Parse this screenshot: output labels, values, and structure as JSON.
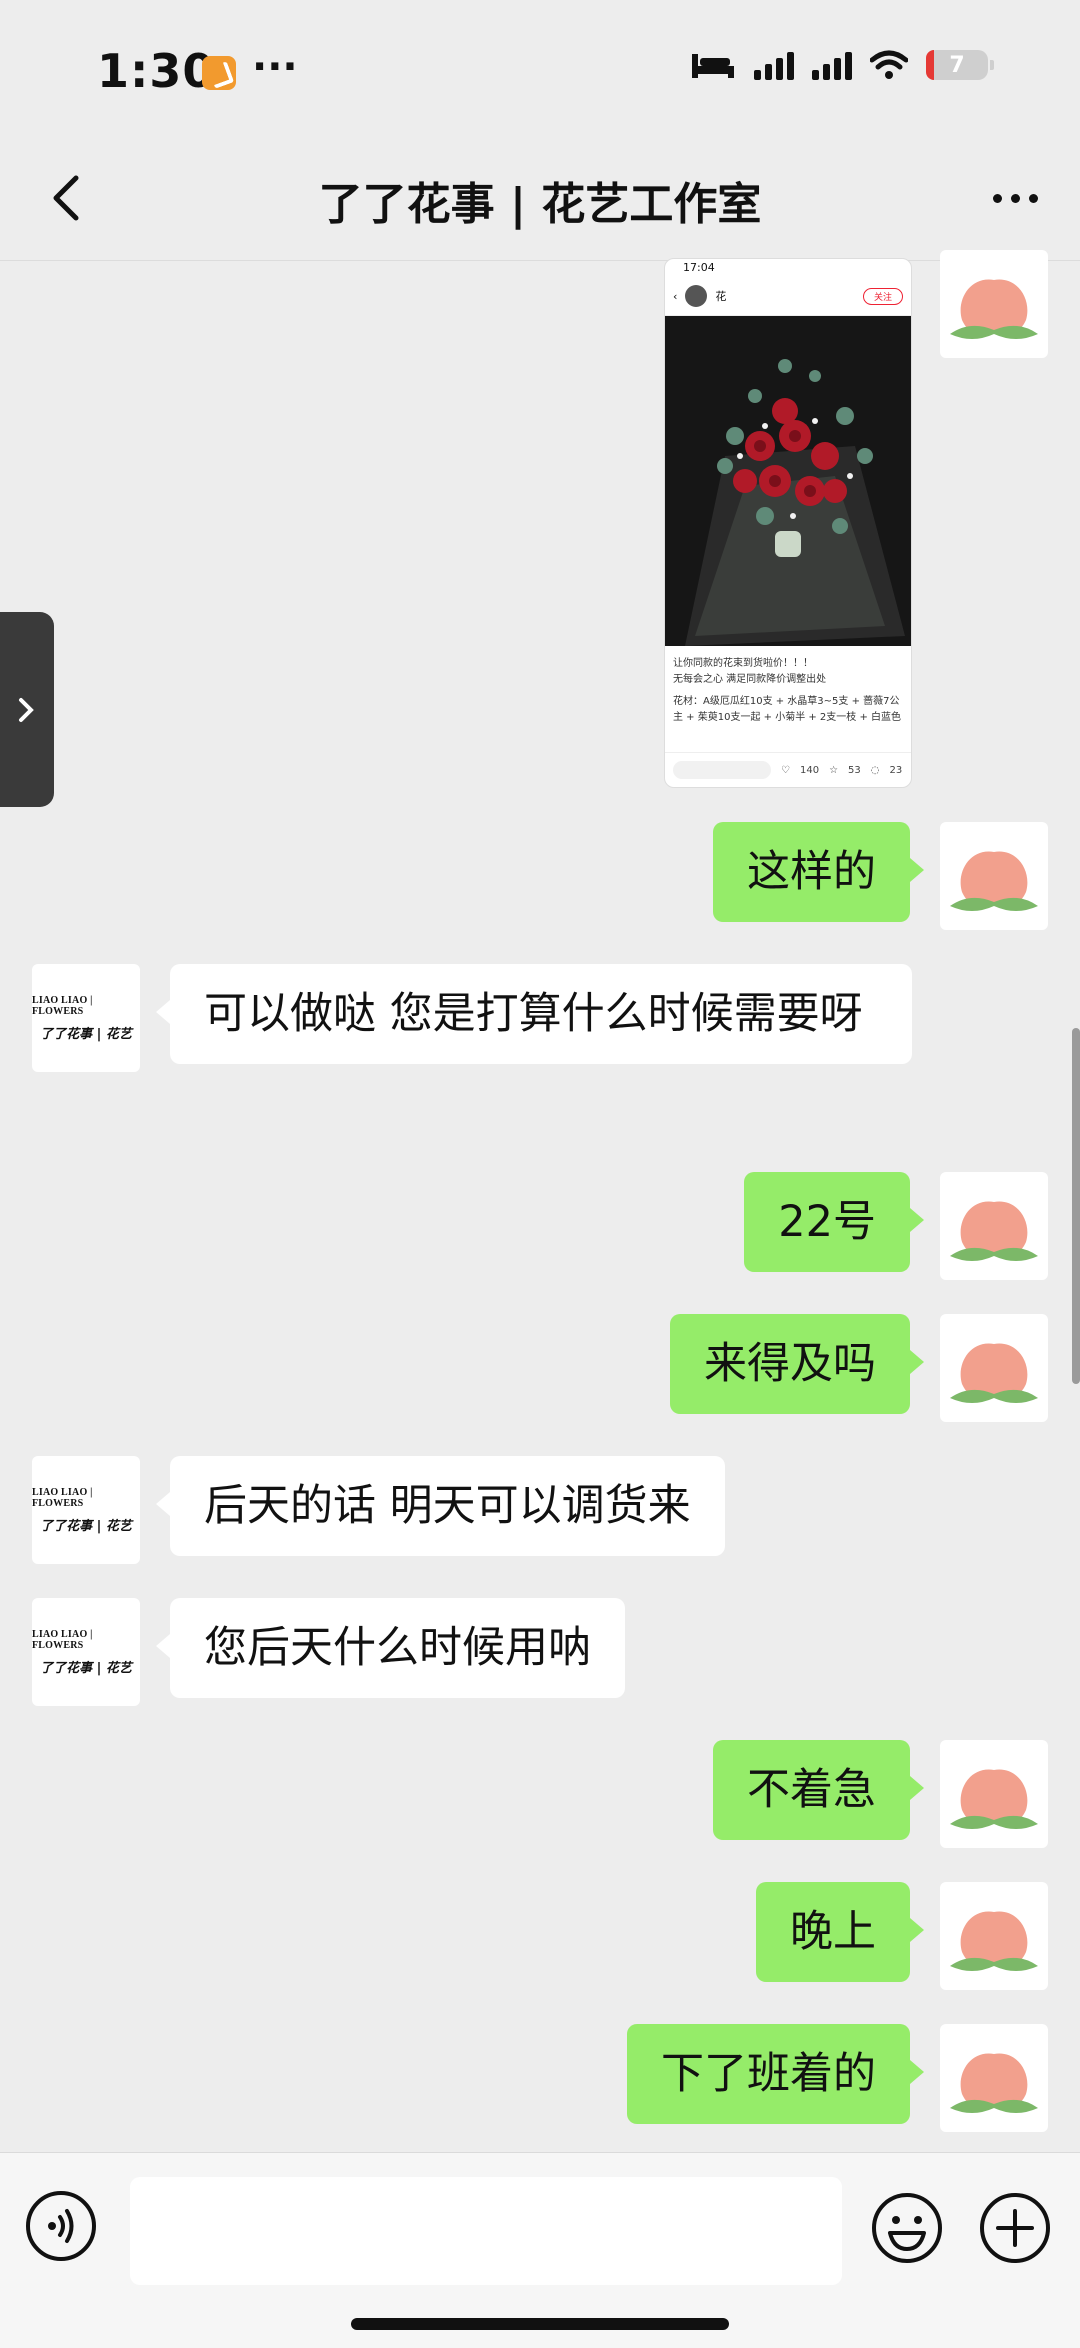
{
  "status_bar": {
    "time": "1:30",
    "more": "···",
    "battery": "7"
  },
  "header": {
    "title": "了了花事 | 花艺工作室"
  },
  "shop": {
    "logo_line1": "LIAO LIAO | FLOWERS",
    "logo_line2": "了了花事 | 花艺"
  },
  "shared_post": {
    "time": "17:04",
    "author": "花",
    "follow": "关注",
    "caption_title": "让你同款的花束到货啦价！！！",
    "caption_line2": "无每会之心 满足同款降价调整出处",
    "caption_line3": "花材：A级厄瓜红10支 + 水晶草3~5支 + 蔷薇7公主 + 茱萸10支一起 + 小菊半 + 2支一枝 + 白蓝色包装",
    "likes": "140",
    "stars": "53",
    "comments": "23"
  },
  "messages": [
    {
      "side": "out",
      "text": "这样的"
    },
    {
      "side": "in",
      "text": "可以做哒 您是打算什么时候需要呀"
    },
    {
      "side": "out",
      "text": "22号"
    },
    {
      "side": "out",
      "text": "来得及吗"
    },
    {
      "side": "in",
      "text": "后天的话 明天可以调货来"
    },
    {
      "side": "in",
      "text": "您后天什么时候用呐"
    },
    {
      "side": "out",
      "text": "不着急"
    },
    {
      "side": "out",
      "text": "晚上"
    },
    {
      "side": "out",
      "text": "下了班着的"
    }
  ],
  "input": {
    "value": "",
    "placeholder": ""
  },
  "colors": {
    "outgoing_bubble": "#95ec69",
    "incoming_bubble": "#ffffff",
    "background": "#ededed"
  }
}
